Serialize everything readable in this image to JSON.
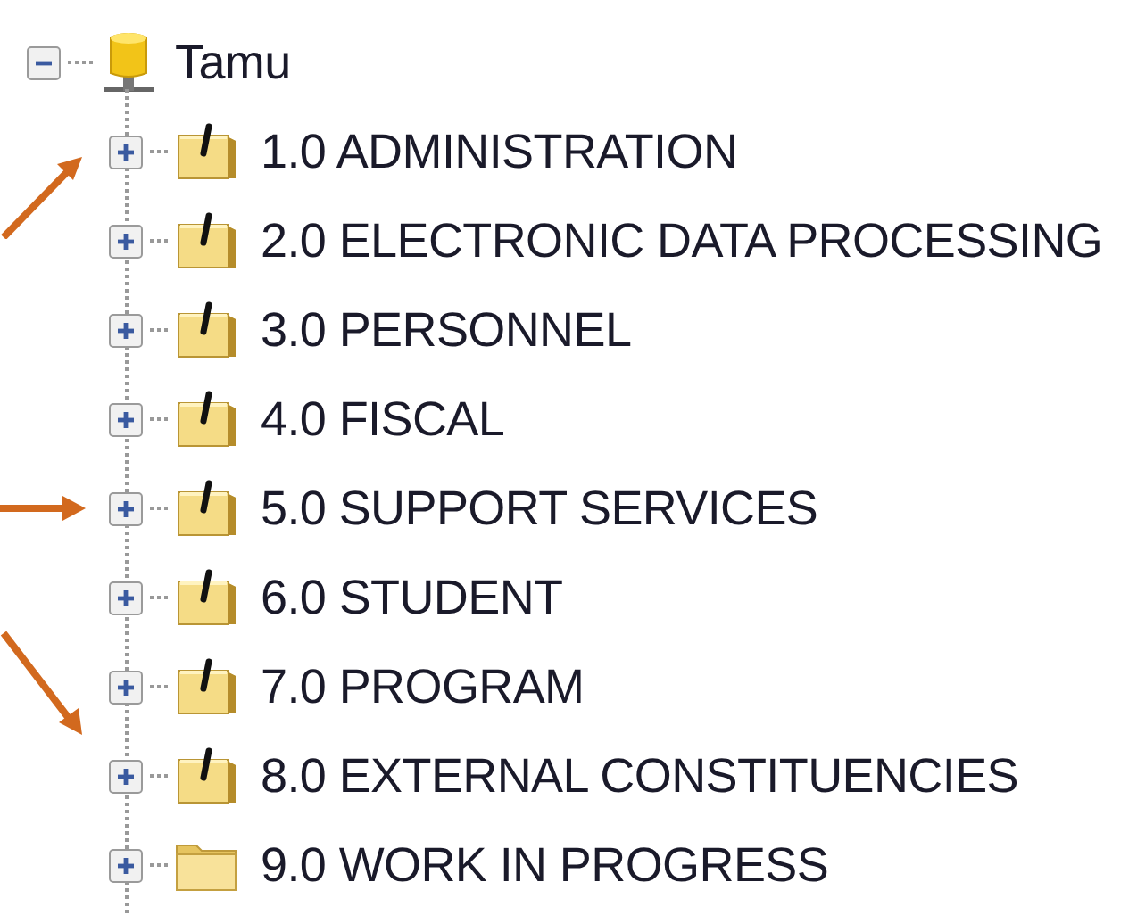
{
  "tree": {
    "label": "Tamu",
    "expanded": true,
    "children": [
      {
        "label": "1.0 ADMINISTRATION",
        "kind": "box",
        "expanded": false,
        "arrow": {
          "kind": "rising"
        }
      },
      {
        "label": "2.0 ELECTRONIC DATA PROCESSING",
        "kind": "box",
        "expanded": false
      },
      {
        "label": "3.0 PERSONNEL",
        "kind": "box",
        "expanded": false
      },
      {
        "label": "4.0 FISCAL",
        "kind": "box",
        "expanded": false
      },
      {
        "label": "5.0 SUPPORT SERVICES",
        "kind": "box",
        "expanded": false,
        "arrow": {
          "kind": "level"
        }
      },
      {
        "label": "6.0 STUDENT",
        "kind": "box",
        "expanded": false
      },
      {
        "label": "7.0 PROGRAM",
        "kind": "box",
        "expanded": false
      },
      {
        "label": "8.0 EXTERNAL CONSTITUENCIES",
        "kind": "box",
        "expanded": false,
        "arrow": {
          "kind": "falling"
        }
      },
      {
        "label": "9.0 WORK IN PROGRESS",
        "kind": "folder",
        "expanded": false
      }
    ]
  }
}
